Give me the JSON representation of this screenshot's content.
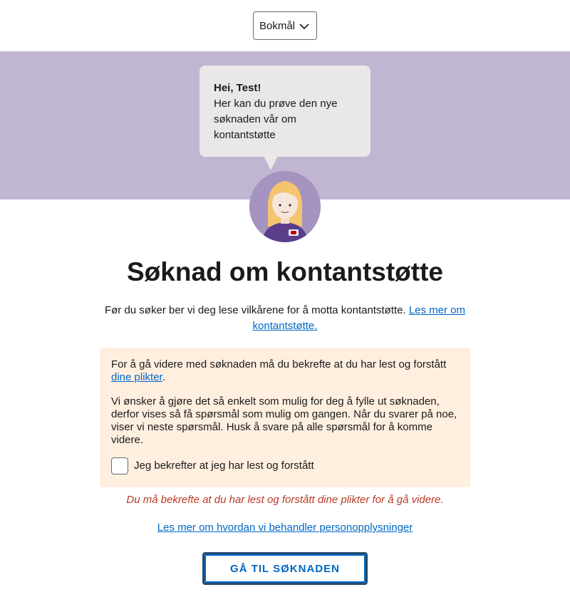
{
  "language_select": {
    "value": "Bokmål",
    "icon": "chevron-down-icon"
  },
  "banner": {
    "greeting": "Hei, Test!",
    "message": "Her kan du prøve den nye søknaden vår om kontantstøtte",
    "background_color": "#c1b6d2",
    "bubble_color": "#e9e7e7"
  },
  "avatar": {
    "icon": "veileder-avatar-icon"
  },
  "page_title": "Søknad om kontantstøtte",
  "intro": {
    "text": "Før du søker ber vi deg lese vilkårene for å motta kontantstøtte. ",
    "link_label": "Les mer om kontantstøtte."
  },
  "info_box": {
    "paragraph1_text": "For å gå videre med søknaden må du bekrefte at du har lest og forstått ",
    "paragraph1_link": "dine plikter",
    "paragraph1_end": ".",
    "paragraph2": "Vi ønsker å gjøre det så enkelt som mulig for deg å fylle ut søknaden, derfor vises så få spørsmål som mulig om gangen. Når du svarer på noe, viser vi neste spørsmål. Husk å svare på alle spørsmål for å komme videre.",
    "checkbox_label": "Jeg bekrefter at jeg har lest og forstått",
    "checkbox_checked": false,
    "background_color": "#ffefdf"
  },
  "error_message": "Du må bekrefte at du har lest og forstått dine plikter for å gå videre.",
  "privacy_link": "Les mer om hvordan vi behandler personopplysninger",
  "start_button": "GÅ TIL SØKNADEN",
  "colors": {
    "link": "#0067c5",
    "error": "#ba3a26",
    "button_border": "#254b6d"
  }
}
